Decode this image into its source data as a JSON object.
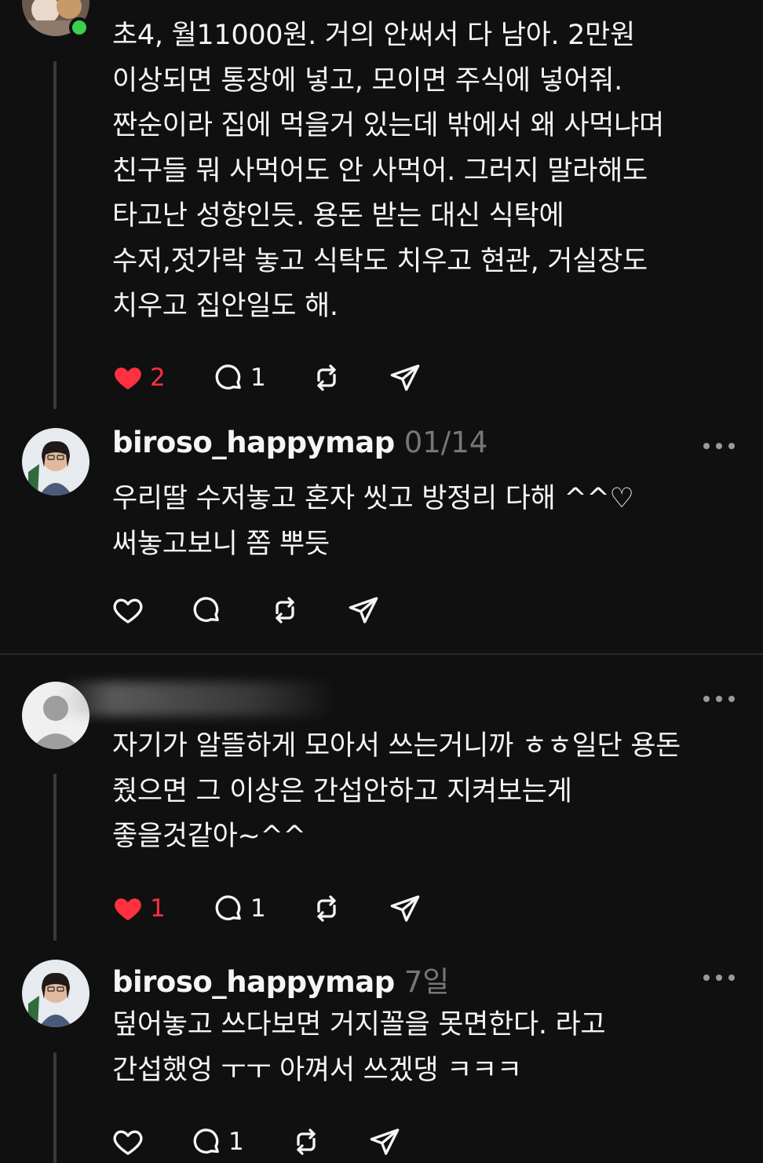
{
  "posts": [
    {
      "lines": [
        "초4, 월11000원. 거의 안써서 다 남아. 2만원",
        "이상되면 통장에 넣고, 모이면 주식에 넣어줘.",
        "짠순이라 집에 먹을거 있는데 밖에서 왜 사먹냐며",
        "친구들 뭐 사먹어도 안 사먹어. 그러지 말라해도",
        "타고난 성향인듯. 용돈 받는 대신 식탁에",
        "수저,젓가락 놓고 식탁도 치우고 현관, 거실장도",
        "치우고 집안일도 해."
      ],
      "likes": "2",
      "replies": "1",
      "liked": true
    },
    {
      "username": "biroso_happymap",
      "time": "01/14",
      "lines": [
        "우리딸 수저놓고 혼자 씻고 방정리 다해 ^^♡",
        "써놓고보니 쫌 뿌듯"
      ],
      "likes": "",
      "replies": ""
    },
    {
      "username": "",
      "time": "",
      "lines": [
        "자기가 알뜰하게 모아서 쓰는거니까 ㅎㅎ일단 용돈",
        "줬으면 그 이상은 간섭안하고 지켜보는게",
        "좋을것같아~^^"
      ],
      "likes": "1",
      "replies": "1",
      "liked": true
    },
    {
      "username": "biroso_happymap",
      "time": "7일",
      "lines": [
        "덮어놓고 쓰다보면 거지꼴을 못면한다. 라고",
        "간섭했엉 ㅜㅜ 아껴서 쓰겠댕 ㅋㅋㅋ"
      ],
      "likes": "",
      "replies": "1"
    }
  ],
  "colors": {
    "background": "#101010",
    "text": "#f3f5f7",
    "muted": "#777777",
    "like_red": "#ff3040",
    "online": "#3ccf4e"
  },
  "icons": [
    "heart-icon",
    "comment-icon",
    "repost-icon",
    "share-icon",
    "more-icon"
  ]
}
